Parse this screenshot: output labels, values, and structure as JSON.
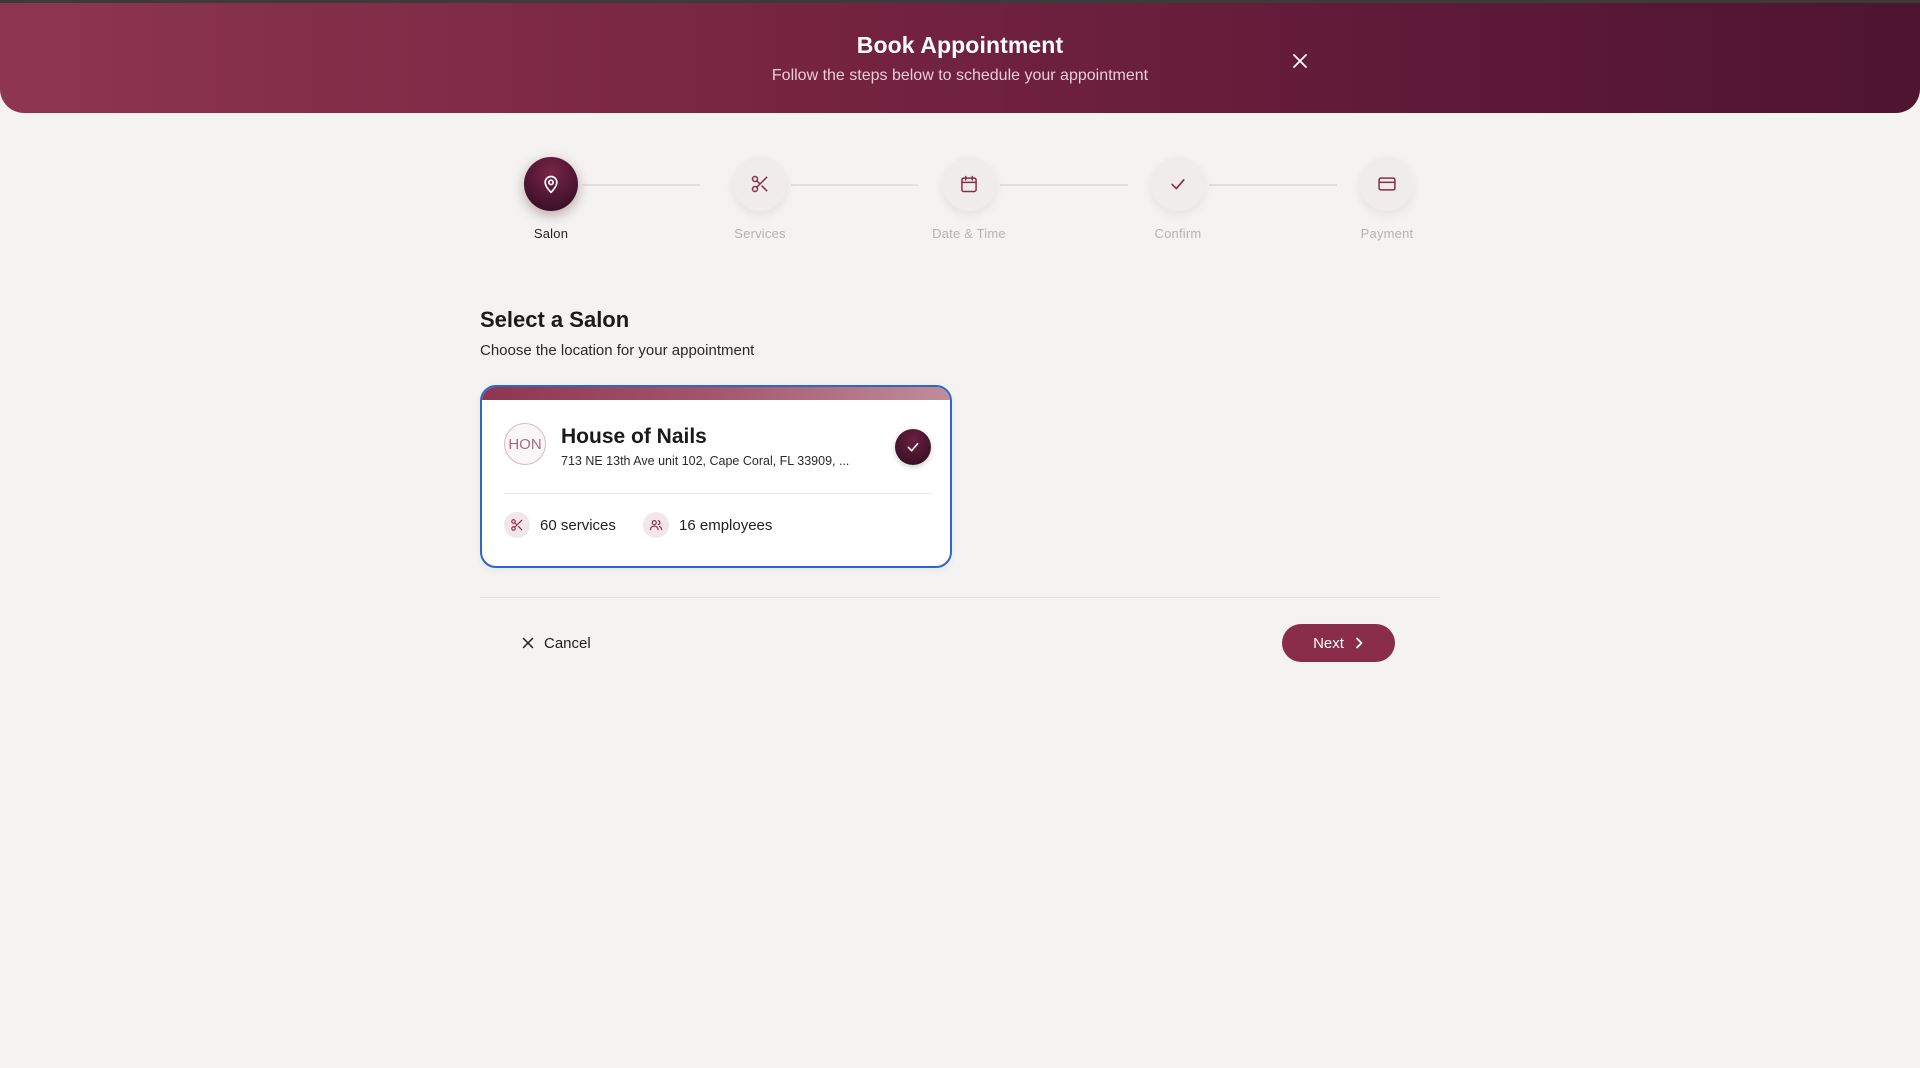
{
  "header": {
    "title": "Book Appointment",
    "subtitle": "Follow the steps below to schedule your appointment",
    "close_icon": "close-icon"
  },
  "steps": [
    {
      "label": "Salon",
      "icon": "map-pin-icon",
      "active": true
    },
    {
      "label": "Services",
      "icon": "scissors-icon",
      "active": false
    },
    {
      "label": "Date & Time",
      "icon": "calendar-icon",
      "active": false
    },
    {
      "label": "Confirm",
      "icon": "check-icon",
      "active": false
    },
    {
      "label": "Payment",
      "icon": "credit-card-icon",
      "active": false
    }
  ],
  "main": {
    "title": "Select a Salon",
    "subtitle": "Choose the location for your appointment"
  },
  "salon": {
    "initials": "HON",
    "name": "House of Nails",
    "address": "713 NE 13th Ave unit 102, Cape Coral, FL 33909, ...",
    "services": "60 services",
    "employees": "16 employees",
    "selected": true
  },
  "footer": {
    "cancel_label": "Cancel",
    "next_label": "Next"
  },
  "colors": {
    "brand": "#8a2d4b",
    "brand_dark": "#4a1530",
    "selection_border": "#2f66c9",
    "background": "#f4f3f1"
  }
}
